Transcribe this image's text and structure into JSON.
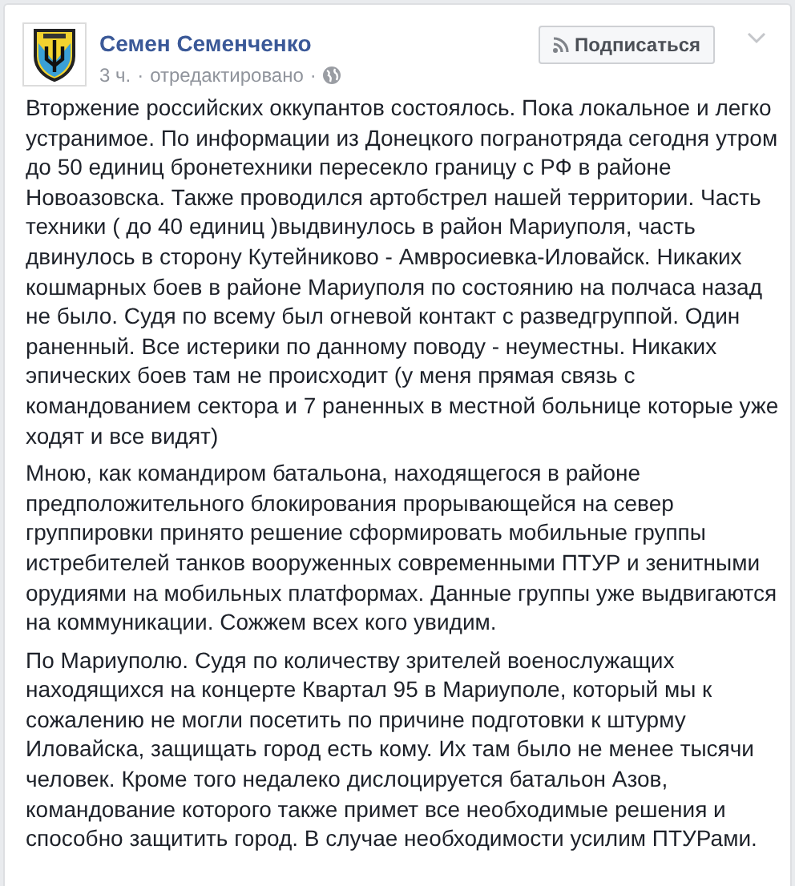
{
  "post": {
    "author": "Семен Семенченко",
    "time": "3 ч.",
    "separator": "·",
    "edited": "отредактировано",
    "subscribe_button": "Подписаться",
    "paragraphs": [
      "Вторжение российских оккупантов состоялось. Пока локальное и легко устранимое. По информации из Донецкого погранотряда сегодня утром до 50 единиц бронетехники пересекло границу с РФ в районе Новоазовска. Также проводился артобстрел нашей территории. Часть техники ( до 40 единиц )выдвинулось в район Мариуполя, часть двинулось в сторону Кутейниково - Амвросиевка-Иловайск. Никаких кошмарных боев в районе Мариуполя по состоянию на полчаса назад не было. Судя по всему был огневой контакт с разведгруппой. Один раненный. Все истерики по данному поводу - неуместны. Никаких эпических боев там не происходит (у меня прямая связь с командованием сектора и 7 раненных в местной больнице которые уже ходят и все видят)",
      "Мною, как командиром батальона, находящегося в районе предположительного блокирования прорывающейся на север группировки принято решение сформировать мобильные группы истребителей танков вооруженных современными ПТУР и зенитными орудиями на мобильных платформах. Данные группы уже выдвигаются на коммуникации. Сожжем всех кого увидим.",
      "По Мариуполю. Судя по количеству зрителей военослужащих находящихся на концерте Квартал 95 в Мариуполе, который мы к сожалению не могли посетить по причине подготовки к штурму Иловайска, защищать город есть кому. Их там было не менее тысячи человек. Кроме того недалеко дислоцируется батальон Азов, командование которого также примет все необходимые решения и способно защитить город. В случае необходимости усилим ПТУРами."
    ]
  }
}
